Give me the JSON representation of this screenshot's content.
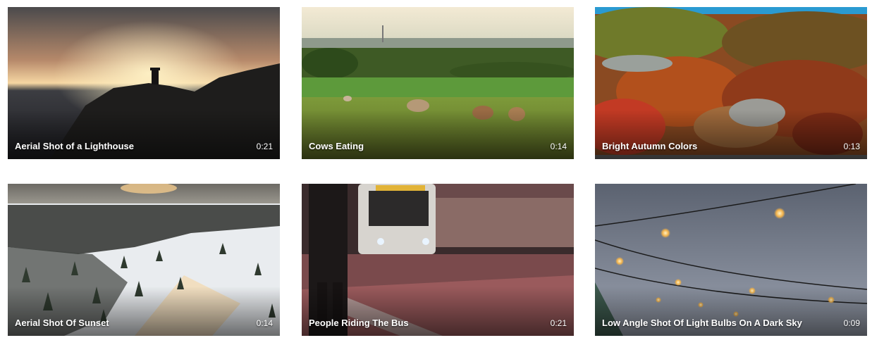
{
  "videos": [
    {
      "title": "Aerial Shot of a Lighthouse",
      "duration": "0:21"
    },
    {
      "title": "Cows Eating",
      "duration": "0:14"
    },
    {
      "title": "Bright Autumn Colors",
      "duration": "0:13"
    },
    {
      "title": "Aerial Shot Of Sunset",
      "duration": "0:14"
    },
    {
      "title": "People Riding The Bus",
      "duration": "0:21"
    },
    {
      "title": "Low Angle Shot Of Light Bulbs On A Dark Sky",
      "duration": "0:09"
    }
  ]
}
